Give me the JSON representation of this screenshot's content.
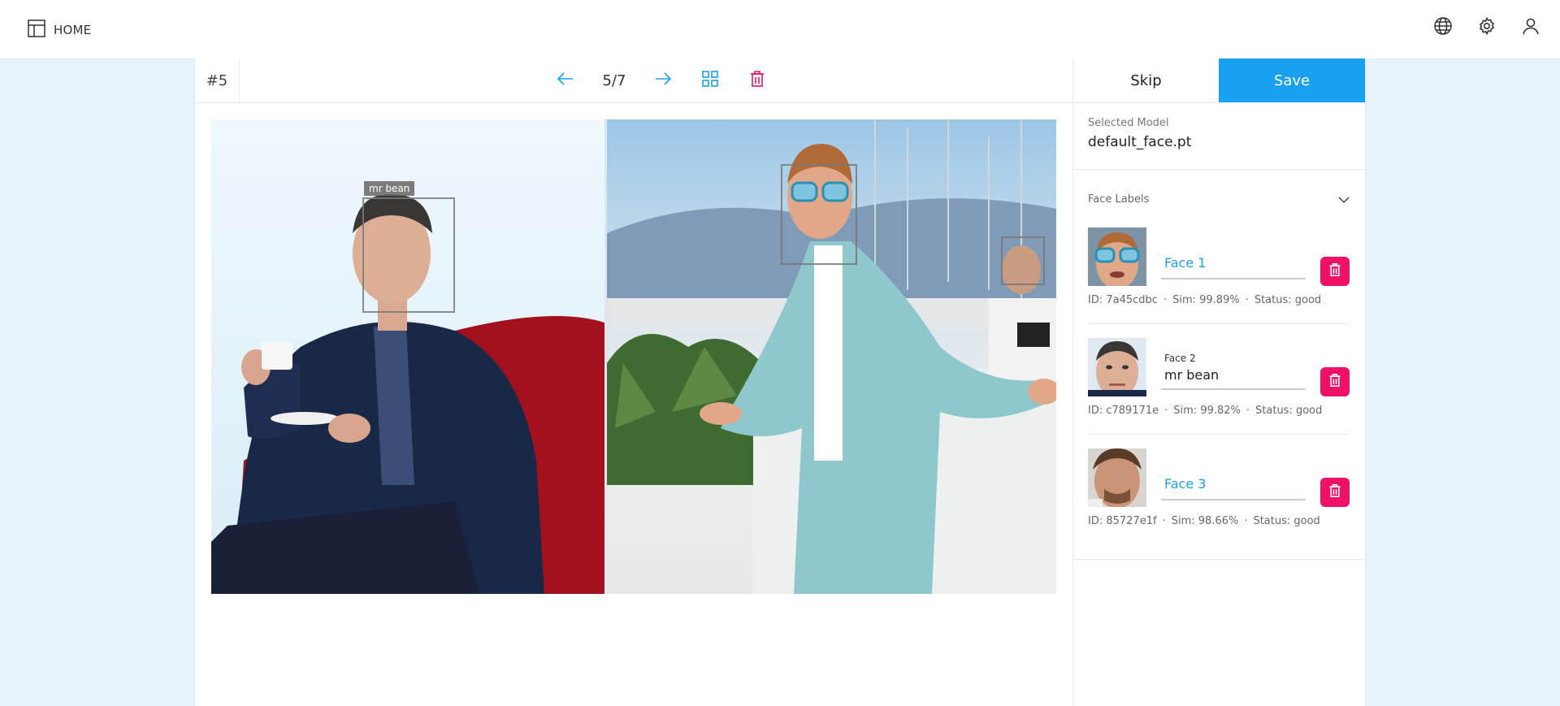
{
  "header": {
    "home_label": "HOME",
    "icons": [
      "home-layout-icon",
      "globe-icon",
      "gear-icon",
      "user-icon"
    ]
  },
  "toolbar": {
    "index": "#5",
    "pager": "5/7",
    "icons": [
      "arrow-left-icon",
      "arrow-right-icon",
      "grid-icon",
      "trash-icon"
    ]
  },
  "canvas": {
    "box_label": "mr bean"
  },
  "actions": {
    "skip": "Skip",
    "save": "Save"
  },
  "model": {
    "label": "Selected Model",
    "value": "default_face.pt"
  },
  "face_labels": {
    "title": "Face Labels",
    "items": [
      {
        "placeholder": "Face 1",
        "label_small": "",
        "value": "",
        "id": "ID: 7a45cdbc",
        "sim": "Sim: 99.89%",
        "status": "Status: good"
      },
      {
        "placeholder": "",
        "label_small": "Face 2",
        "value": "mr bean",
        "id": "ID: c789171e",
        "sim": "Sim: 99.82%",
        "status": "Status: good"
      },
      {
        "placeholder": "Face 3",
        "label_small": "",
        "value": "",
        "id": "ID: 85727e1f",
        "sim": "Sim: 98.66%",
        "status": "Status: good"
      }
    ]
  },
  "colors": {
    "accent": "#1aa0f0",
    "delete": "#ee1166",
    "background": "#e6f3fd"
  }
}
